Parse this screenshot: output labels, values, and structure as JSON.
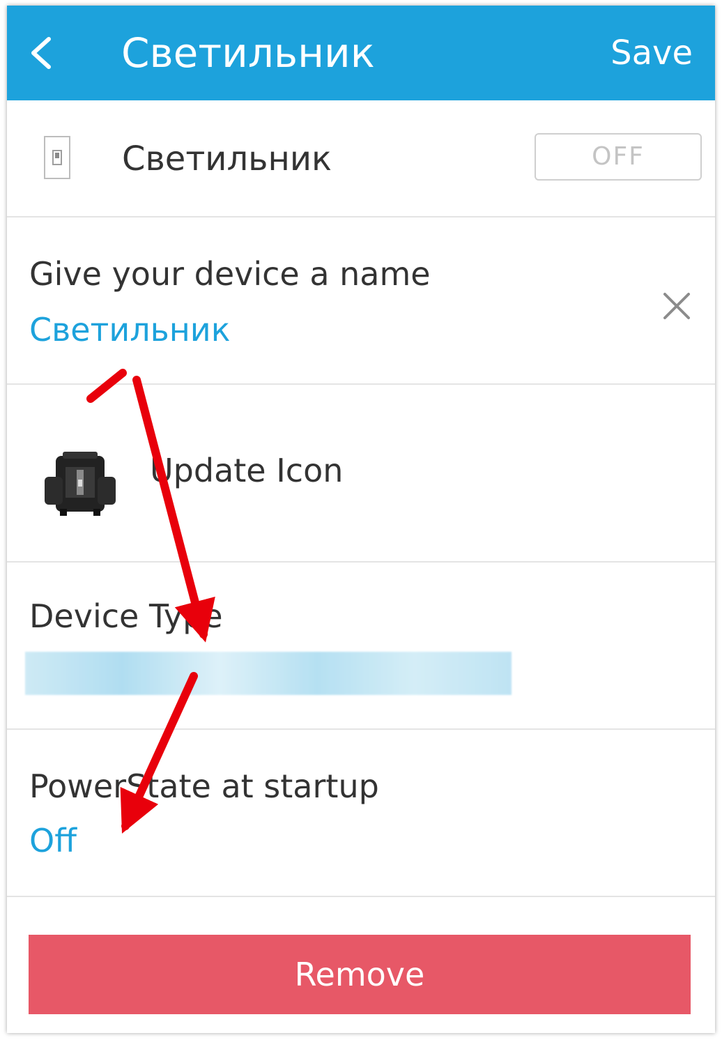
{
  "colors": {
    "accent": "#1da2dc",
    "danger": "#e75867",
    "annotation_arrow": "#e8000b"
  },
  "header": {
    "back_icon": "chevron-left-icon",
    "title": "Светильник",
    "save_label": "Save"
  },
  "device_row": {
    "icon": "light-switch-icon",
    "name": "Светильник",
    "toggle_label": "OFF"
  },
  "name_field": {
    "label": "Give your device a name",
    "value": "Светильник",
    "clear_icon": "close-icon"
  },
  "icon_row": {
    "icon": "device-image-icon",
    "label": "Update Icon"
  },
  "device_type": {
    "label": "Device Type",
    "value_blurred": true
  },
  "power_state": {
    "label": "PowerState at startup",
    "value": "Off"
  },
  "remove_button": {
    "label": "Remove"
  }
}
